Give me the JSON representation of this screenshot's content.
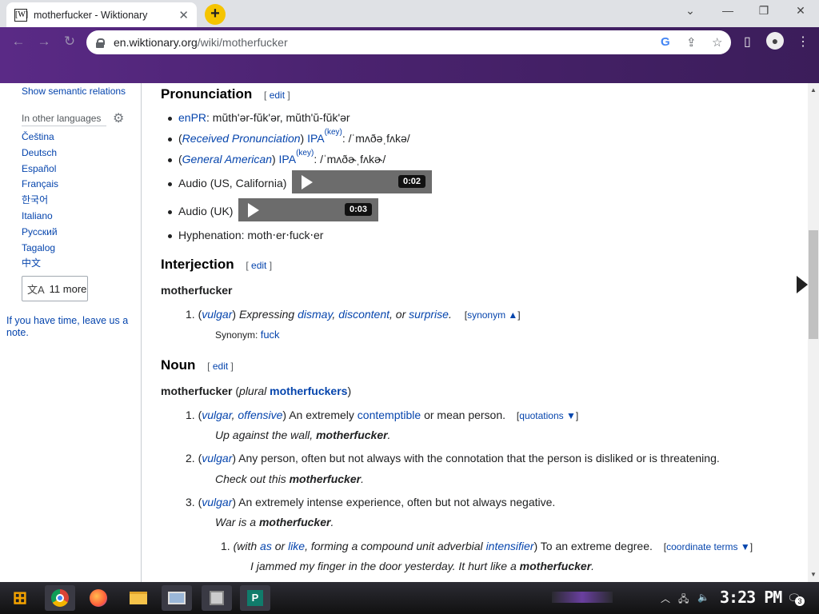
{
  "browser": {
    "tab_title": "motherfucker - Wiktionary",
    "tab_favicon_text": "[W]",
    "new_tab_label": "+",
    "url_host": "en.wiktionary.org",
    "url_path": "/wiki/motherfucker"
  },
  "sidebar": {
    "semantic_link": "Show semantic relations",
    "in_other_languages": "In other languages",
    "languages": [
      "Čeština",
      "Deutsch",
      "Español",
      "Français",
      "한국어",
      "Italiano",
      "Русский",
      "Tagalog",
      "中文"
    ],
    "more_label": "11 more",
    "note": "If you have time, leave us a note."
  },
  "pronunciation": {
    "heading": "Pronunciation",
    "edit": "edit",
    "enpr_label": "enPR",
    "enpr_value": ": mŭth'ər-fŭk'ər, mŭth'ŭ-fŭk'ər",
    "rp_label": "Received Pronunciation",
    "gam_label": "General American",
    "ipa": "IPA",
    "key": "(key)",
    "rp_ipa": ": /ˈmʌðəˌfʌkə/",
    "gam_ipa": ": /ˈmʌðɚˌfʌkɚ/",
    "audio_us_label": "Audio (US, California)",
    "audio_us_time": "0:02",
    "audio_uk_label": "Audio (UK)",
    "audio_uk_time": "0:03",
    "hyphenation": "Hyphenation: moth‧er‧fuck‧er"
  },
  "interjection": {
    "heading": "Interjection",
    "edit": "edit",
    "headword": "motherfucker",
    "sense_tag": "vulgar",
    "sense_text_pre": "Expressing",
    "w1": "dismay",
    "w2": "discontent",
    "w3": "surprise",
    "or": ", or",
    "synonym_toggle": "synonym ▲",
    "synonym_label": "Synonym:",
    "synonym_value": "fuck"
  },
  "noun": {
    "heading": "Noun",
    "edit": "edit",
    "headword": "motherfucker",
    "plural_label": "plural",
    "plural_value": "motherfuckers",
    "s1_tag1": "vulgar",
    "s1_tag2": "offensive",
    "s1_pre": "An extremely",
    "s1_link": "contemptible",
    "s1_post": "or mean person.",
    "quotations_toggle": "quotations ▼",
    "s1_example_pre": "Up against the wall, ",
    "s1_example_bold": "motherfucker",
    "s2_tag": "vulgar",
    "s2_text": "Any person, often but not always with the connotation that the person is disliked or is threatening.",
    "s2_example_pre": "Check out this ",
    "s2_example_bold": "motherfucker",
    "s3_tag": "vulgar",
    "s3_text": "An extremely intense experience, often but not always negative.",
    "s3_example_pre": "War is a ",
    "s3_example_bold": "motherfucker",
    "ss1_with": "with",
    "ss1_as": "as",
    "ss1_or": "or",
    "ss1_like": "like",
    "ss1_mid": ", forming a compound unit adverbial",
    "ss1_intens": "intensifier",
    "ss1_text": "To an extreme degree.",
    "coordinate_toggle": "coordinate terms ▼",
    "ss1_example_pre": "I jammed my finger in the door yesterday. It hurt like a ",
    "ss1_example_bold": "motherfucker"
  },
  "taskbar": {
    "clock": "3:23 PM",
    "notification_count": "3"
  },
  "colors": {
    "chrome_purple": "#4b2370",
    "link": "#0645ad",
    "taskbar": "#111111"
  }
}
